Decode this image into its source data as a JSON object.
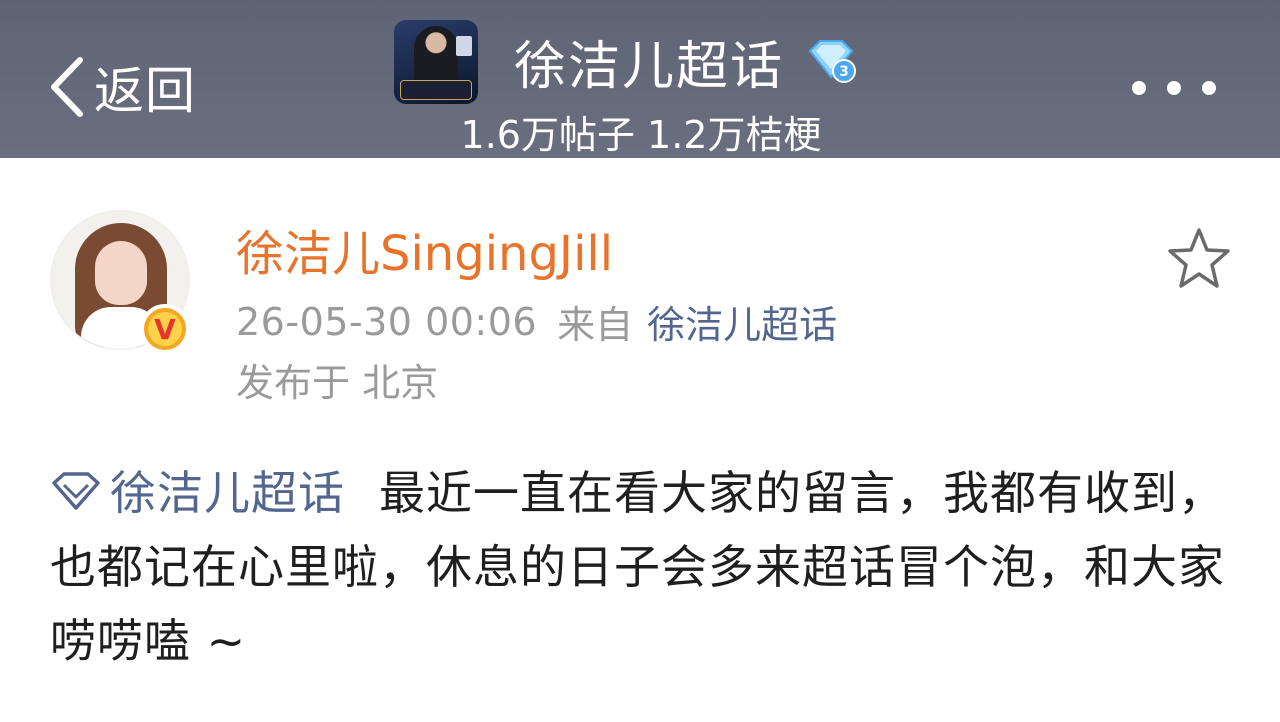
{
  "header": {
    "back_label": "返回",
    "title": "徐洁儿超话",
    "badge_level": "3",
    "stats": "1.6万帖子 1.2万桔梗"
  },
  "post": {
    "author": "徐洁儿SingingJill",
    "time": "26-05-30 00:06",
    "from_label": "来自",
    "source": "徐洁儿超话",
    "location": "发布于 北京",
    "topic": "徐洁儿超话",
    "text": "最近一直在看大家的留言，我都有收到，也都记在心里啦，休息的日子会多来超话冒个泡，和大家唠唠嗑 ~"
  },
  "colors": {
    "header_bg": "#646978",
    "author": "#e8742c",
    "link": "#52668f",
    "meta": "#9a9a9a"
  }
}
